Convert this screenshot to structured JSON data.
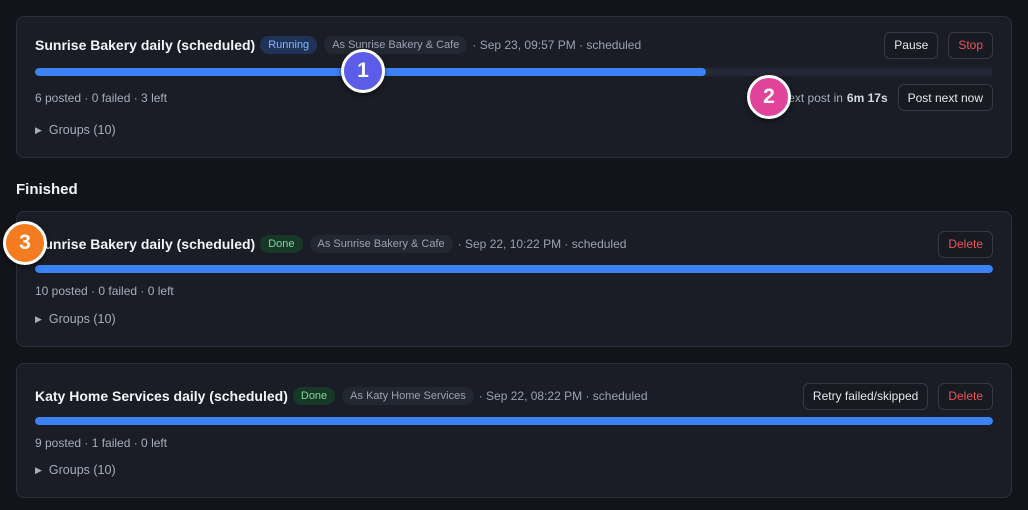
{
  "running": {
    "title": "Sunrise Bakery daily (scheduled)",
    "status": "Running",
    "as_account": "As Sunrise Bakery & Cafe",
    "meta": "· Sep 23, 09:57 PM · scheduled",
    "progress": 0.7,
    "stats": "6 posted · 0 failed · 3 left",
    "groups": "Groups (10)",
    "next_post_label": "Next post in",
    "next_post_time": "6m 17s",
    "buttons": {
      "pause": "Pause",
      "stop": "Stop",
      "post_next": "Post next now"
    }
  },
  "finished": {
    "heading": "Finished",
    "jobs": [
      {
        "title": "Sunrise Bakery daily (scheduled)",
        "status": "Done",
        "as_account": "As Sunrise Bakery & Cafe",
        "meta": "· Sep 22, 10:22 PM · scheduled",
        "progress": 1.0,
        "stats": "10 posted · 0 failed · 0 left",
        "groups": "Groups (10)",
        "buttons": {
          "delete": "Delete"
        }
      },
      {
        "title": "Katy Home Services daily (scheduled)",
        "status": "Done",
        "as_account": "As Katy Home Services",
        "meta": "· Sep 22, 08:22 PM · scheduled",
        "progress": 1.0,
        "stats": "9 posted · 1 failed · 0 left",
        "groups": "Groups (10)",
        "buttons": {
          "retry": "Retry failed/skipped",
          "delete": "Delete"
        }
      }
    ]
  },
  "markers": [
    "1",
    "2",
    "3"
  ],
  "colors": {
    "accent": "#3b82f6",
    "danger": "#f0525a",
    "marker_1": "#5b5ce8",
    "marker_2": "#e2439a",
    "marker_3": "#f47b20"
  }
}
